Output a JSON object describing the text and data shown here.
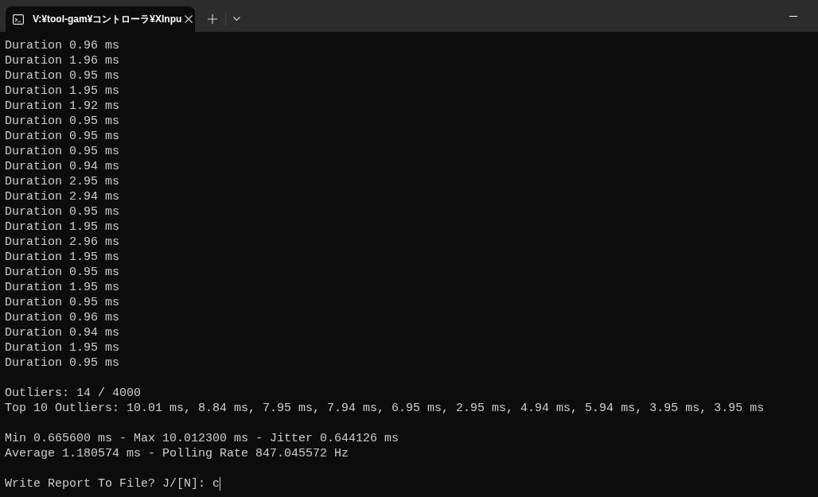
{
  "window": {
    "tab": {
      "title": "V:¥tool-gam¥コントローラ¥XInpu",
      "selected": true
    }
  },
  "terminal": {
    "blocks": [
      {
        "lines": [
          "Duration 0.96 ms",
          "Duration 1.96 ms",
          "Duration 0.95 ms",
          "Duration 1.95 ms",
          "Duration 1.92 ms",
          "Duration 0.95 ms",
          "Duration 0.95 ms",
          "Duration 0.95 ms",
          "Duration 0.94 ms",
          "Duration 2.95 ms",
          "Duration 2.94 ms",
          "Duration 0.95 ms",
          "Duration 1.95 ms",
          "Duration 2.96 ms",
          "Duration 1.95 ms",
          "Duration 0.95 ms",
          "Duration 1.95 ms",
          "Duration 0.95 ms",
          "Duration 0.96 ms",
          "Duration 0.94 ms",
          "Duration 1.95 ms",
          "Duration 0.95 ms"
        ]
      },
      {
        "lines": [
          "Outliers: 14 / 4000",
          "Top 10 Outliers: 10.01 ms, 8.84 ms, 7.95 ms, 7.94 ms, 6.95 ms, 2.95 ms, 4.94 ms, 5.94 ms, 3.95 ms, 3.95 ms"
        ]
      },
      {
        "lines": [
          "Min 0.665600 ms - Max 10.012300 ms - Jitter 0.644126 ms",
          "Average 1.180574 ms - Polling Rate 847.045572 Hz"
        ]
      }
    ],
    "prompt": {
      "text": "Write Report To File? J/[N]:",
      "input": "c"
    }
  }
}
